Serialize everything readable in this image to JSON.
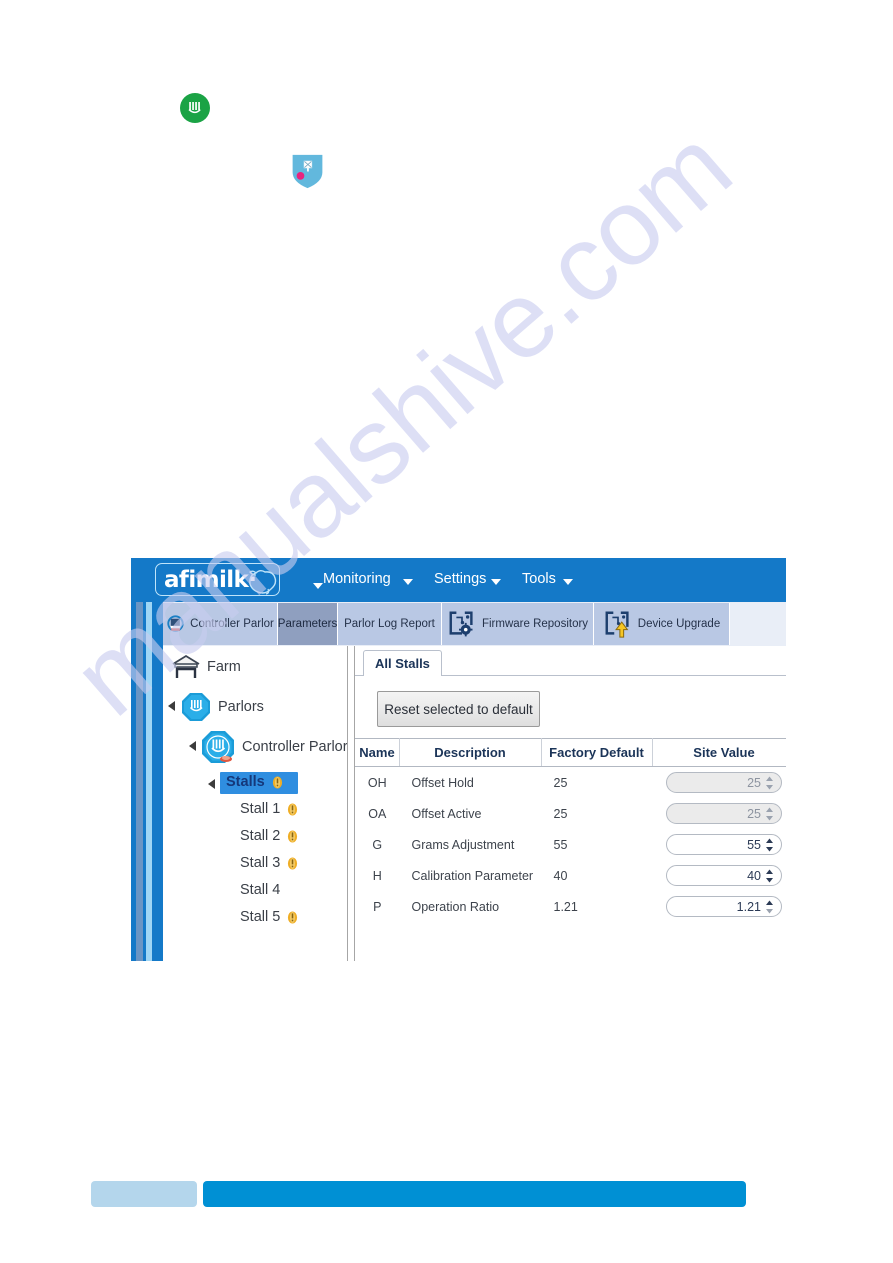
{
  "watermark": {
    "text": "manualshive.com"
  },
  "stray_icons": [
    {
      "name": "milking-cluster-green-badge",
      "color": "#1ba345"
    },
    {
      "name": "shield-alert-badge",
      "color": "#62b8dd",
      "dot_color": "#e8247e"
    }
  ],
  "app": {
    "header": {
      "logo_text": "afimilk·",
      "menus": [
        {
          "label": "Monitoring"
        },
        {
          "label": "Settings"
        },
        {
          "label": "Tools"
        }
      ]
    },
    "ribbon_tabs": [
      {
        "label": "Controller Parlor",
        "icon": "controller-parlor-icon",
        "selected": false
      },
      {
        "label": "Parameters",
        "icon": "",
        "selected": true
      },
      {
        "label": "Parlor Log Report",
        "icon": "",
        "selected": false
      },
      {
        "label": "Firmware Repository",
        "icon": "firmware-repository-icon",
        "selected": false
      },
      {
        "label": "Device Upgrade",
        "icon": "device-upgrade-icon",
        "selected": false
      }
    ],
    "tree": [
      {
        "label": "Farm",
        "icon": "barn-icon",
        "indent": 0,
        "expander": false,
        "warning": false,
        "selected": false
      },
      {
        "label": "Parlors",
        "icon": "parlor-icon",
        "indent": 0,
        "expander": true,
        "warning": false,
        "selected": false
      },
      {
        "label": "Controller Parlor",
        "icon": "controller-parlor-node-icon",
        "indent": 1,
        "expander": true,
        "warning": false,
        "selected": false
      },
      {
        "label": "Stalls",
        "icon": "",
        "indent": 2,
        "expander": true,
        "warning": true,
        "selected": true
      },
      {
        "label": "Stall 1",
        "icon": "",
        "indent": 3,
        "expander": false,
        "warning": true,
        "selected": false
      },
      {
        "label": "Stall 2",
        "icon": "",
        "indent": 3,
        "expander": false,
        "warning": true,
        "selected": false
      },
      {
        "label": "Stall 3",
        "icon": "",
        "indent": 3,
        "expander": false,
        "warning": true,
        "selected": false
      },
      {
        "label": "Stall 4",
        "icon": "",
        "indent": 3,
        "expander": false,
        "warning": false,
        "selected": false
      },
      {
        "label": "Stall 5",
        "icon": "",
        "indent": 3,
        "expander": false,
        "warning": true,
        "selected": false
      }
    ],
    "content": {
      "subtab_label": "All Stalls",
      "reset_button_label": "Reset selected to default",
      "table": {
        "columns": [
          "Name",
          "Description",
          "Factory Default",
          "Site Value"
        ],
        "rows": [
          {
            "name": "OH",
            "description": "Offset Hold",
            "factory_default": "25",
            "site_value": "25",
            "disabled": true
          },
          {
            "name": "OA",
            "description": "Offset Active",
            "factory_default": "25",
            "site_value": "25",
            "disabled": true
          },
          {
            "name": "G",
            "description": "Grams Adjustment",
            "factory_default": "55",
            "site_value": "55",
            "disabled": false
          },
          {
            "name": "H",
            "description": "Calibration Parameter",
            "factory_default": "40",
            "site_value": "40",
            "disabled": false
          },
          {
            "name": "P",
            "description": "Operation Ratio",
            "factory_default": "1.21",
            "site_value": "1.21",
            "disabled": false
          }
        ]
      }
    }
  },
  "footer": {
    "left_bar_color": "#b4d6ec",
    "right_bar_color": "#0090d4"
  },
  "colors": {
    "header_blue": "#1479c8",
    "tab_blue": "#b9c8e4",
    "tab_selected": "#8f9fbf",
    "tree_selected": "#2f8ee0",
    "warning_amber": "#e8a21c"
  }
}
